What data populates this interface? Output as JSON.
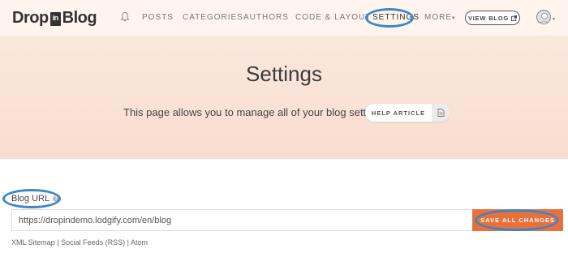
{
  "logo": {
    "part1": "Drop",
    "badge": "in",
    "part2": "Blog"
  },
  "nav": {
    "bell_icon": "bell-icon",
    "items": [
      {
        "label": "POSTS"
      },
      {
        "label": "CATEGORIES"
      },
      {
        "label": "AUTHORS"
      },
      {
        "label": "CODE & LAYOUT"
      },
      {
        "label": "SETTINGS"
      },
      {
        "label": "MORE"
      }
    ],
    "more_caret": "▾",
    "view_blog_label": "VIEW BLOG",
    "view_blog_icon": "external-link-icon",
    "avatar_icon": "user-avatar-icon",
    "avatar_caret": "▾"
  },
  "hero": {
    "title": "Settings",
    "description": "This page allows you to manage all of your blog settings.",
    "help_label": "HELP ARTICLE",
    "help_icon": "document-icon"
  },
  "form": {
    "blog_url_label": "Blog URL",
    "info_icon": "?",
    "blog_url_value": "https://dropindemo.lodgify.com/en/blog",
    "save_label": "SAVE ALL CHANGES"
  },
  "footer": {
    "links": [
      "XML Sitemap",
      "Social Feeds (RSS)",
      "Atom"
    ],
    "separator": "|"
  },
  "colors": {
    "accent": "#e8703a",
    "annotation": "#3d86c6",
    "hero_bg": "#fae2d6"
  }
}
